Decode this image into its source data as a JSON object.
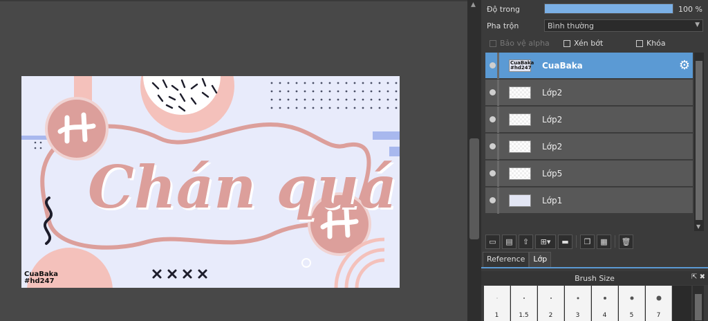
{
  "properties": {
    "opacity_label": "Độ trong",
    "opacity_value": "100 %",
    "opacity_fraction": 1.0,
    "blend_label": "Pha trộn",
    "blend_value": "Bình thường",
    "protect_alpha_label": "Bảo vệ alpha",
    "clip_label": "Xén bớt",
    "lock_label": "Khóa"
  },
  "layers": [
    {
      "name": "CuaBaka",
      "thumb_text": "CuaBaka #hd247",
      "selected": true
    },
    {
      "name": "Lớp2",
      "thumb_text": ""
    },
    {
      "name": "Lớp2",
      "thumb_text": ""
    },
    {
      "name": "Lớp2",
      "thumb_text": ""
    },
    {
      "name": "Lớp5",
      "thumb_text": ""
    },
    {
      "name": "Lớp1",
      "thumb_text": ""
    }
  ],
  "tabs": {
    "reference": "Reference",
    "layer": "Lớp"
  },
  "brush": {
    "title": "Brush Size",
    "sizes": [
      "1",
      "1.5",
      "2",
      "3",
      "4",
      "5",
      "7"
    ]
  },
  "artwork": {
    "watermark_line1": "CuaBaka",
    "watermark_line2": "#hd247",
    "title_text": "Chán quá",
    "colors": {
      "bg": "#e8ebfb",
      "pink": "#dc9f9b",
      "light_pink": "#f4c1bb",
      "blue": "#a8b8ee",
      "navy": "#2f3556"
    }
  },
  "colors": {
    "accent": "#5b9ad4",
    "panel": "#3b3b3b",
    "layer_bg": "#585858"
  }
}
